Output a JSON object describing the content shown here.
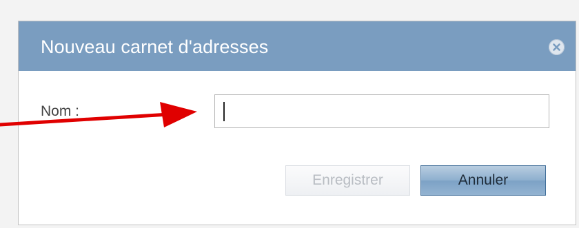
{
  "dialog": {
    "title": "Nouveau carnet d'adresses",
    "close_icon": "close-circle-icon"
  },
  "form": {
    "name_label": "Nom :",
    "name_value": "",
    "name_placeholder": ""
  },
  "buttons": {
    "save_label": "Enregistrer",
    "save_disabled": true,
    "cancel_label": "Annuler"
  },
  "annotation": {
    "arrow_color": "#e00000"
  },
  "colors": {
    "header": "#7a9dc0",
    "cancel_button": "#7da2c6",
    "background": "#f3f3f3"
  }
}
